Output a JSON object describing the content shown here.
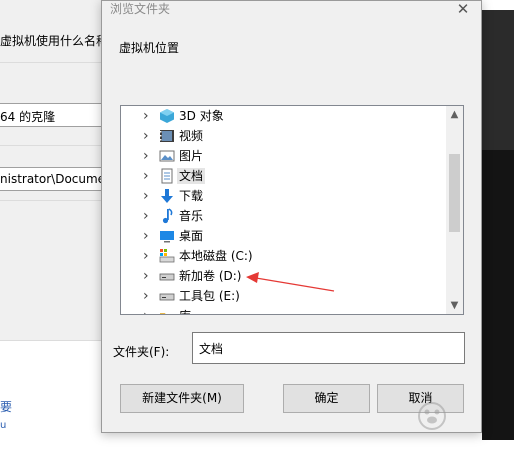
{
  "background_window": {
    "question_text": "虚拟机使用什么名称?",
    "name_value": "64 的克隆",
    "location_value": "nistrator\\Documen",
    "link_text": "要",
    "link_dot": "u"
  },
  "dialog": {
    "title": "浏览文件夹",
    "description": "虚拟机位置",
    "tree": [
      {
        "label": "3D 对象",
        "icon": "3d-objects-icon"
      },
      {
        "label": "视频",
        "icon": "video-icon"
      },
      {
        "label": "图片",
        "icon": "pictures-icon"
      },
      {
        "label": "文档",
        "icon": "documents-icon",
        "selected": true
      },
      {
        "label": "下载",
        "icon": "download-icon"
      },
      {
        "label": "音乐",
        "icon": "music-icon"
      },
      {
        "label": "桌面",
        "icon": "desktop-icon"
      },
      {
        "label": "本地磁盘 (C:)",
        "icon": "local-disk-icon"
      },
      {
        "label": "新加卷 (D:)",
        "icon": "drive-icon"
      },
      {
        "label": "工具包 (E:)",
        "icon": "drive-icon"
      },
      {
        "label": "库",
        "icon": "library-icon"
      }
    ],
    "folder_label": "文件夹(F):",
    "folder_value": "文档",
    "buttons": {
      "new_folder": "新建文件夹(M)",
      "ok": "确定",
      "cancel": "取消"
    }
  },
  "watermark_text": "Baidu 经验",
  "colors": {
    "annotation_arrow": "#e53935",
    "dialog_bg": "#f0f0f0",
    "selection": "#e5e5e5"
  }
}
